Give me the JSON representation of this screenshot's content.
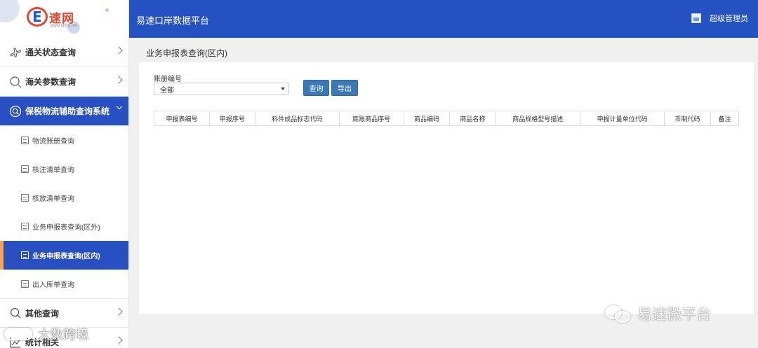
{
  "brand": {
    "logo_letter": "E",
    "logo_text": "速网",
    "logo_sub": "www.ethro.net"
  },
  "header": {
    "platform_title": "易速口岸数据平台",
    "user_name": "超级管理员"
  },
  "sidebar": {
    "menu_top": [
      {
        "label": "通关状态查询",
        "icon": "airplane-icon"
      },
      {
        "label": "海关参数查询",
        "icon": "search-icon"
      },
      {
        "label": "保税物流辅助查询系统",
        "icon": "search-circle-icon",
        "expanded": true
      }
    ],
    "sub_items": [
      {
        "label": "物流账册查询",
        "icon": "ledger-icon"
      },
      {
        "label": "核注清单查询",
        "icon": "list-icon"
      },
      {
        "label": "核放清单查询",
        "icon": "list-icon"
      },
      {
        "label": "业务申报表查询(区外)",
        "icon": "form-icon"
      },
      {
        "label": "业务申报表查询(区内)",
        "icon": "form-icon",
        "selected": true
      },
      {
        "label": "出入库单查询",
        "icon": "doc-icon"
      }
    ],
    "menu_bottom": [
      {
        "label": "其他查询",
        "icon": "search-icon"
      },
      {
        "label": "统计相关",
        "icon": "chart-icon"
      }
    ]
  },
  "main": {
    "page_heading": "业务申报表查询(区内)",
    "filter": {
      "label": "账册编号",
      "selected": "全部"
    },
    "buttons": {
      "query": "查询",
      "export": "导出"
    },
    "table_headers": [
      "申报表编号",
      "申报序号",
      "料件成品标志代码",
      "底账商品序号",
      "商品编码",
      "商品名称",
      "商品规格型号描述",
      "申报计量单位代码",
      "币制代码",
      "备注"
    ]
  },
  "watermarks": {
    "right": "易速微平台",
    "left": "大数跨境"
  }
}
